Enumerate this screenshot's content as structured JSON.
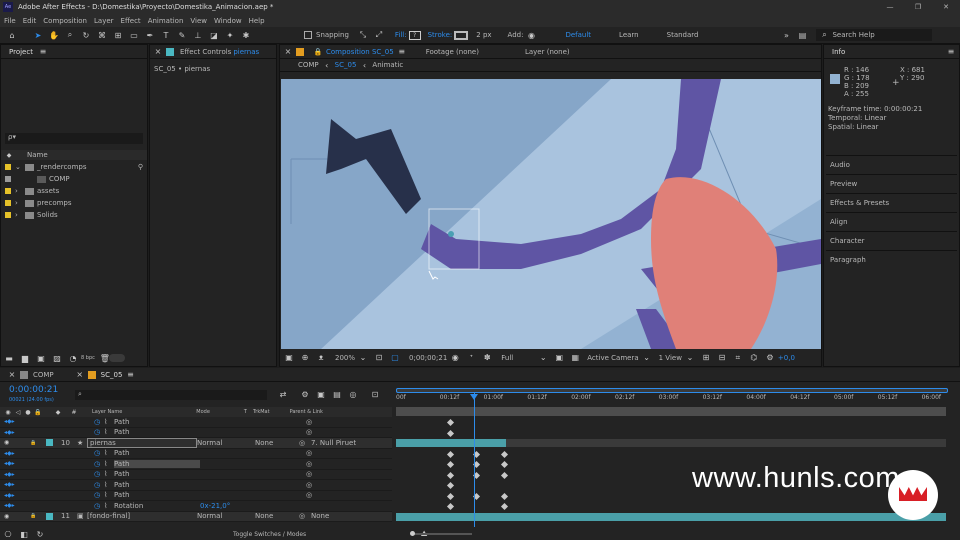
{
  "window": {
    "title": "Adobe After Effects - D:\\Domestika\\Proyecto\\Domestika_Animacion.aep *",
    "controls": [
      "—",
      "❐",
      "✕"
    ]
  },
  "menu": [
    "File",
    "Edit",
    "Composition",
    "Layer",
    "Effect",
    "Animation",
    "View",
    "Window",
    "Help"
  ],
  "toolbar": {
    "snapping": "Snapping",
    "fill": "Fill:",
    "stroke": "Stroke:",
    "stroke_width": "2 px",
    "add": "Add:",
    "workspaces": [
      "Default",
      "Learn",
      "Standard"
    ],
    "search_placeholder": "Search Help"
  },
  "project": {
    "title": "Project",
    "effect_controls_tab": "Effect Controls",
    "effect_controls_layer": "piernas",
    "subtitle": "SC_05 • piernas",
    "search_prefix": "ρ▾",
    "column_name": "Name",
    "items": [
      {
        "name": "_rendercomps",
        "type": "folder",
        "color": "#e6c229",
        "open": true
      },
      {
        "name": "COMP",
        "type": "comp",
        "color": "#9a9a9a",
        "child": true
      },
      {
        "name": "assets",
        "type": "folder",
        "color": "#e6c229"
      },
      {
        "name": "precomps",
        "type": "folder",
        "color": "#e6c229"
      },
      {
        "name": "Solids",
        "type": "folder",
        "color": "#e6c229"
      }
    ],
    "bpc": "8 bpc"
  },
  "composition": {
    "tab": "Composition SC_05",
    "footage_tab": "Footage (none)",
    "layer_tab": "Layer (none)",
    "breadcrumbs": [
      "COMP",
      "SC_05",
      "Animatic"
    ],
    "zoom": "200%",
    "timecode": "0;00;00;21",
    "resolution": "Full",
    "camera": "Active Camera",
    "view": "1 View",
    "exposure": "+0,0"
  },
  "info": {
    "title": "Info",
    "r": "R : 146",
    "g": "G : 178",
    "b": "B : 209",
    "a": "A : 255",
    "x": "X : 681",
    "y": "Y : 290",
    "swatch": "#92b2d1",
    "keyframe_time": "Keyframe time: 0:00:00:21",
    "temporal": "Temporal: Linear",
    "spatial": "Spatial: Linear",
    "panels": [
      "Audio",
      "Preview",
      "Effects & Presets",
      "Align",
      "Character",
      "Paragraph"
    ]
  },
  "timeline": {
    "tabs": [
      "COMP",
      "SC_05"
    ],
    "current_time": "0:00:00:21",
    "frames": "00021 (24.00 fps)",
    "headers": {
      "layer_name": "Layer Name",
      "mode": "Mode",
      "t": "T",
      "trkmat": "TrkMat",
      "parent": "Parent & Link"
    },
    "ruler": [
      "00f",
      "00:12f",
      "01:00f",
      "01:12f",
      "02:00f",
      "02:12f",
      "03:00f",
      "03:12f",
      "04:00f",
      "04:12f",
      "05:00f",
      "05:12f",
      "06:00f"
    ],
    "rows": [
      {
        "kind": "prop",
        "label": "Path"
      },
      {
        "kind": "prop",
        "label": "Path"
      },
      {
        "kind": "layer",
        "num": "10",
        "label": "piernas",
        "mode": "Normal",
        "trkmat": "None",
        "parent": "7. Null Piruet"
      },
      {
        "kind": "prop",
        "label": "Path"
      },
      {
        "kind": "prop",
        "label": "Path",
        "selected": true
      },
      {
        "kind": "prop",
        "label": "Path"
      },
      {
        "kind": "prop",
        "label": "Path"
      },
      {
        "kind": "prop",
        "label": "Path"
      },
      {
        "kind": "prop",
        "label": "Rotation",
        "value": "0x-21,0°"
      },
      {
        "kind": "layer",
        "num": "11",
        "label": "[fondo-final]",
        "mode": "Normal",
        "trkmat": "None",
        "parent": "None"
      }
    ],
    "toggle": "Toggle Switches / Modes"
  },
  "watermark": "www.hunls.com"
}
